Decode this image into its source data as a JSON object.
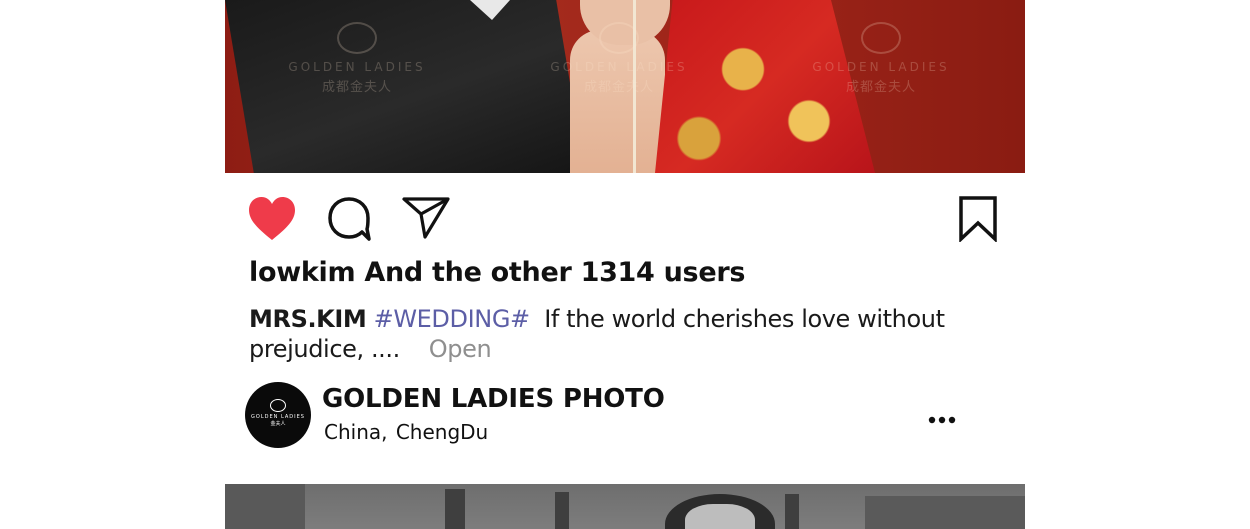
{
  "photo_top": {
    "watermarks": [
      {
        "line1": "GOLDEN LADIES",
        "line2": "成都金夫人"
      },
      {
        "line1": "GOLDEN LADIES",
        "line2": "成都金夫人"
      },
      {
        "line1": "GOLDEN LADIES",
        "line2": "成都金夫人"
      }
    ]
  },
  "actions": {
    "like_icon": "heart-icon",
    "like_color": "#ef3b4a",
    "comment_icon": "comment-icon",
    "share_icon": "share-icon",
    "bookmark_icon": "bookmark-icon"
  },
  "likes": {
    "text": "lowkim And the other 1314 users"
  },
  "caption": {
    "author": "MRS.KIM",
    "hashtag": "#WEDDING#",
    "hashtag_color": "#5c5ea6",
    "text": "If the world cherishes love without prejudice, ....",
    "open_label": "Open"
  },
  "account": {
    "avatar_line1": "GOLDEN LADIES",
    "avatar_line2": "金夫人",
    "name": "GOLDEN LADIES PHOTO",
    "location": "China, ChengDu",
    "more_icon": "more-horizontal-icon"
  }
}
